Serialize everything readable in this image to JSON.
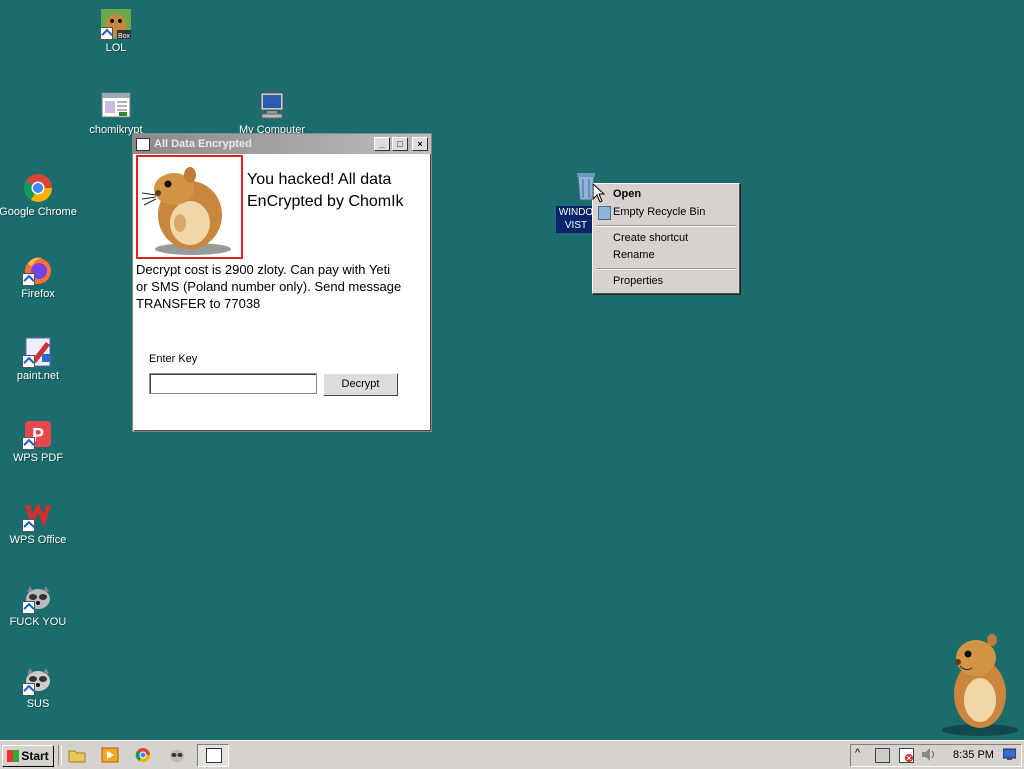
{
  "desktop_icons": [
    {
      "label": "LOL",
      "icon": "hamster-box-icon"
    },
    {
      "label": "chomikrypt",
      "icon": "app-window-icon"
    },
    {
      "label": "My Computer",
      "icon": "computer-icon"
    },
    {
      "label": "Google Chrome",
      "icon": "chrome-icon"
    },
    {
      "label": "Firefox",
      "icon": "firefox-icon"
    },
    {
      "label": "paint.net",
      "icon": "paintnet-icon"
    },
    {
      "label": "WPS PDF",
      "icon": "wps-pdf-icon"
    },
    {
      "label": "WPS Office",
      "icon": "wps-office-icon"
    },
    {
      "label": "FUCK YOU",
      "icon": "raccoon-icon"
    },
    {
      "label": "SUS",
      "icon": "raccoon-icon"
    }
  ],
  "recycle_bin": {
    "label_line1": "WINDO",
    "label_line2": "VIST"
  },
  "window": {
    "title": "All Data Encrypted",
    "headline_line1": "You hacked! All data",
    "headline_line2": "EnCrypted by ChomIk",
    "body_line1": "Decrypt cost is 2900 zloty. Can pay with Yeti",
    "body_line2": "or SMS (Poland number only). Send message",
    "body_line3": "TRANSFER to 77038",
    "key_label": "Enter Key",
    "key_value": "",
    "decrypt_label": "Decrypt",
    "btn_min": "_",
    "btn_max": "□",
    "btn_close": "×"
  },
  "context_menu": {
    "open": "Open",
    "empty_bin": "Empty Recycle Bin",
    "create_shortcut": "Create shortcut",
    "rename": "Rename",
    "properties": "Properties"
  },
  "taskbar": {
    "start_label": "Start",
    "clock": "8:35 PM"
  },
  "colors": {
    "desktop": "#1b6c6c",
    "taskbar": "#d6d3ce",
    "accent_red": "#e02020"
  }
}
